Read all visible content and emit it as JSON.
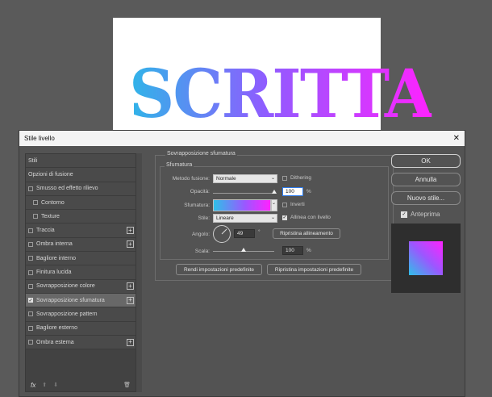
{
  "document": {
    "text": "SCRITTA"
  },
  "dialog": {
    "title": "Stile livello",
    "close_symbol": "✕"
  },
  "styles_panel": {
    "items": [
      {
        "label": "Stili",
        "checkbox": false,
        "plus": false,
        "sub": false
      },
      {
        "label": "Opzioni di fusione",
        "checkbox": false,
        "plus": false,
        "sub": false
      },
      {
        "label": "Smusso ed effetto rilievo",
        "checkbox": true,
        "checked": false,
        "plus": false,
        "sub": false
      },
      {
        "label": "Contorno",
        "checkbox": true,
        "checked": false,
        "plus": false,
        "sub": true
      },
      {
        "label": "Texture",
        "checkbox": true,
        "checked": false,
        "plus": false,
        "sub": true
      },
      {
        "label": "Traccia",
        "checkbox": true,
        "checked": false,
        "plus": true,
        "sub": false
      },
      {
        "label": "Ombra interna",
        "checkbox": true,
        "checked": false,
        "plus": true,
        "sub": false
      },
      {
        "label": "Bagliore interno",
        "checkbox": true,
        "checked": false,
        "plus": false,
        "sub": false
      },
      {
        "label": "Finitura lucida",
        "checkbox": true,
        "checked": false,
        "plus": false,
        "sub": false
      },
      {
        "label": "Sovrapposizione colore",
        "checkbox": true,
        "checked": false,
        "plus": true,
        "sub": false
      },
      {
        "label": "Sovrapposizione sfumatura",
        "checkbox": true,
        "checked": true,
        "plus": true,
        "sub": false,
        "selected": true
      },
      {
        "label": "Sovrapposizione pattern",
        "checkbox": true,
        "checked": false,
        "plus": false,
        "sub": false
      },
      {
        "label": "Bagliore esterno",
        "checkbox": true,
        "checked": false,
        "plus": false,
        "sub": false
      },
      {
        "label": "Ombra esterna",
        "checkbox": true,
        "checked": false,
        "plus": true,
        "sub": false
      }
    ],
    "footer": {
      "fx": "fx",
      "up": "⬆",
      "down": "⬇",
      "trash": "🗑"
    }
  },
  "gradient_overlay": {
    "section_title": "Sovrapposizione sfumatura",
    "group_title": "Sfumatura",
    "blend_mode_label": "Metodo fusione:",
    "blend_mode_value": "Normale",
    "dither_label": "Dithering",
    "opacity_label": "Opacità:",
    "opacity_value": "100",
    "opacity_unit": "%",
    "gradient_label": "Sfumatura:",
    "invert_label": "Inverti",
    "style_label": "Stile:",
    "style_value": "Lineare",
    "align_label": "Allinea con livello",
    "angle_label": "Angolo:",
    "angle_value": "49",
    "angle_unit": "°",
    "reset_align_label": "Ripristina allineamento",
    "scale_label": "Scala:",
    "scale_value": "100",
    "scale_unit": "%",
    "make_default_label": "Rendi impostazioni predefinite",
    "reset_default_label": "Ripristina impostazioni predefinite",
    "opacity_fraction": 1.0,
    "scale_fraction": 0.5
  },
  "right_buttons": {
    "ok": "OK",
    "cancel": "Annulla",
    "new_style": "Nuovo stile...",
    "preview_label": "Anteprima"
  }
}
